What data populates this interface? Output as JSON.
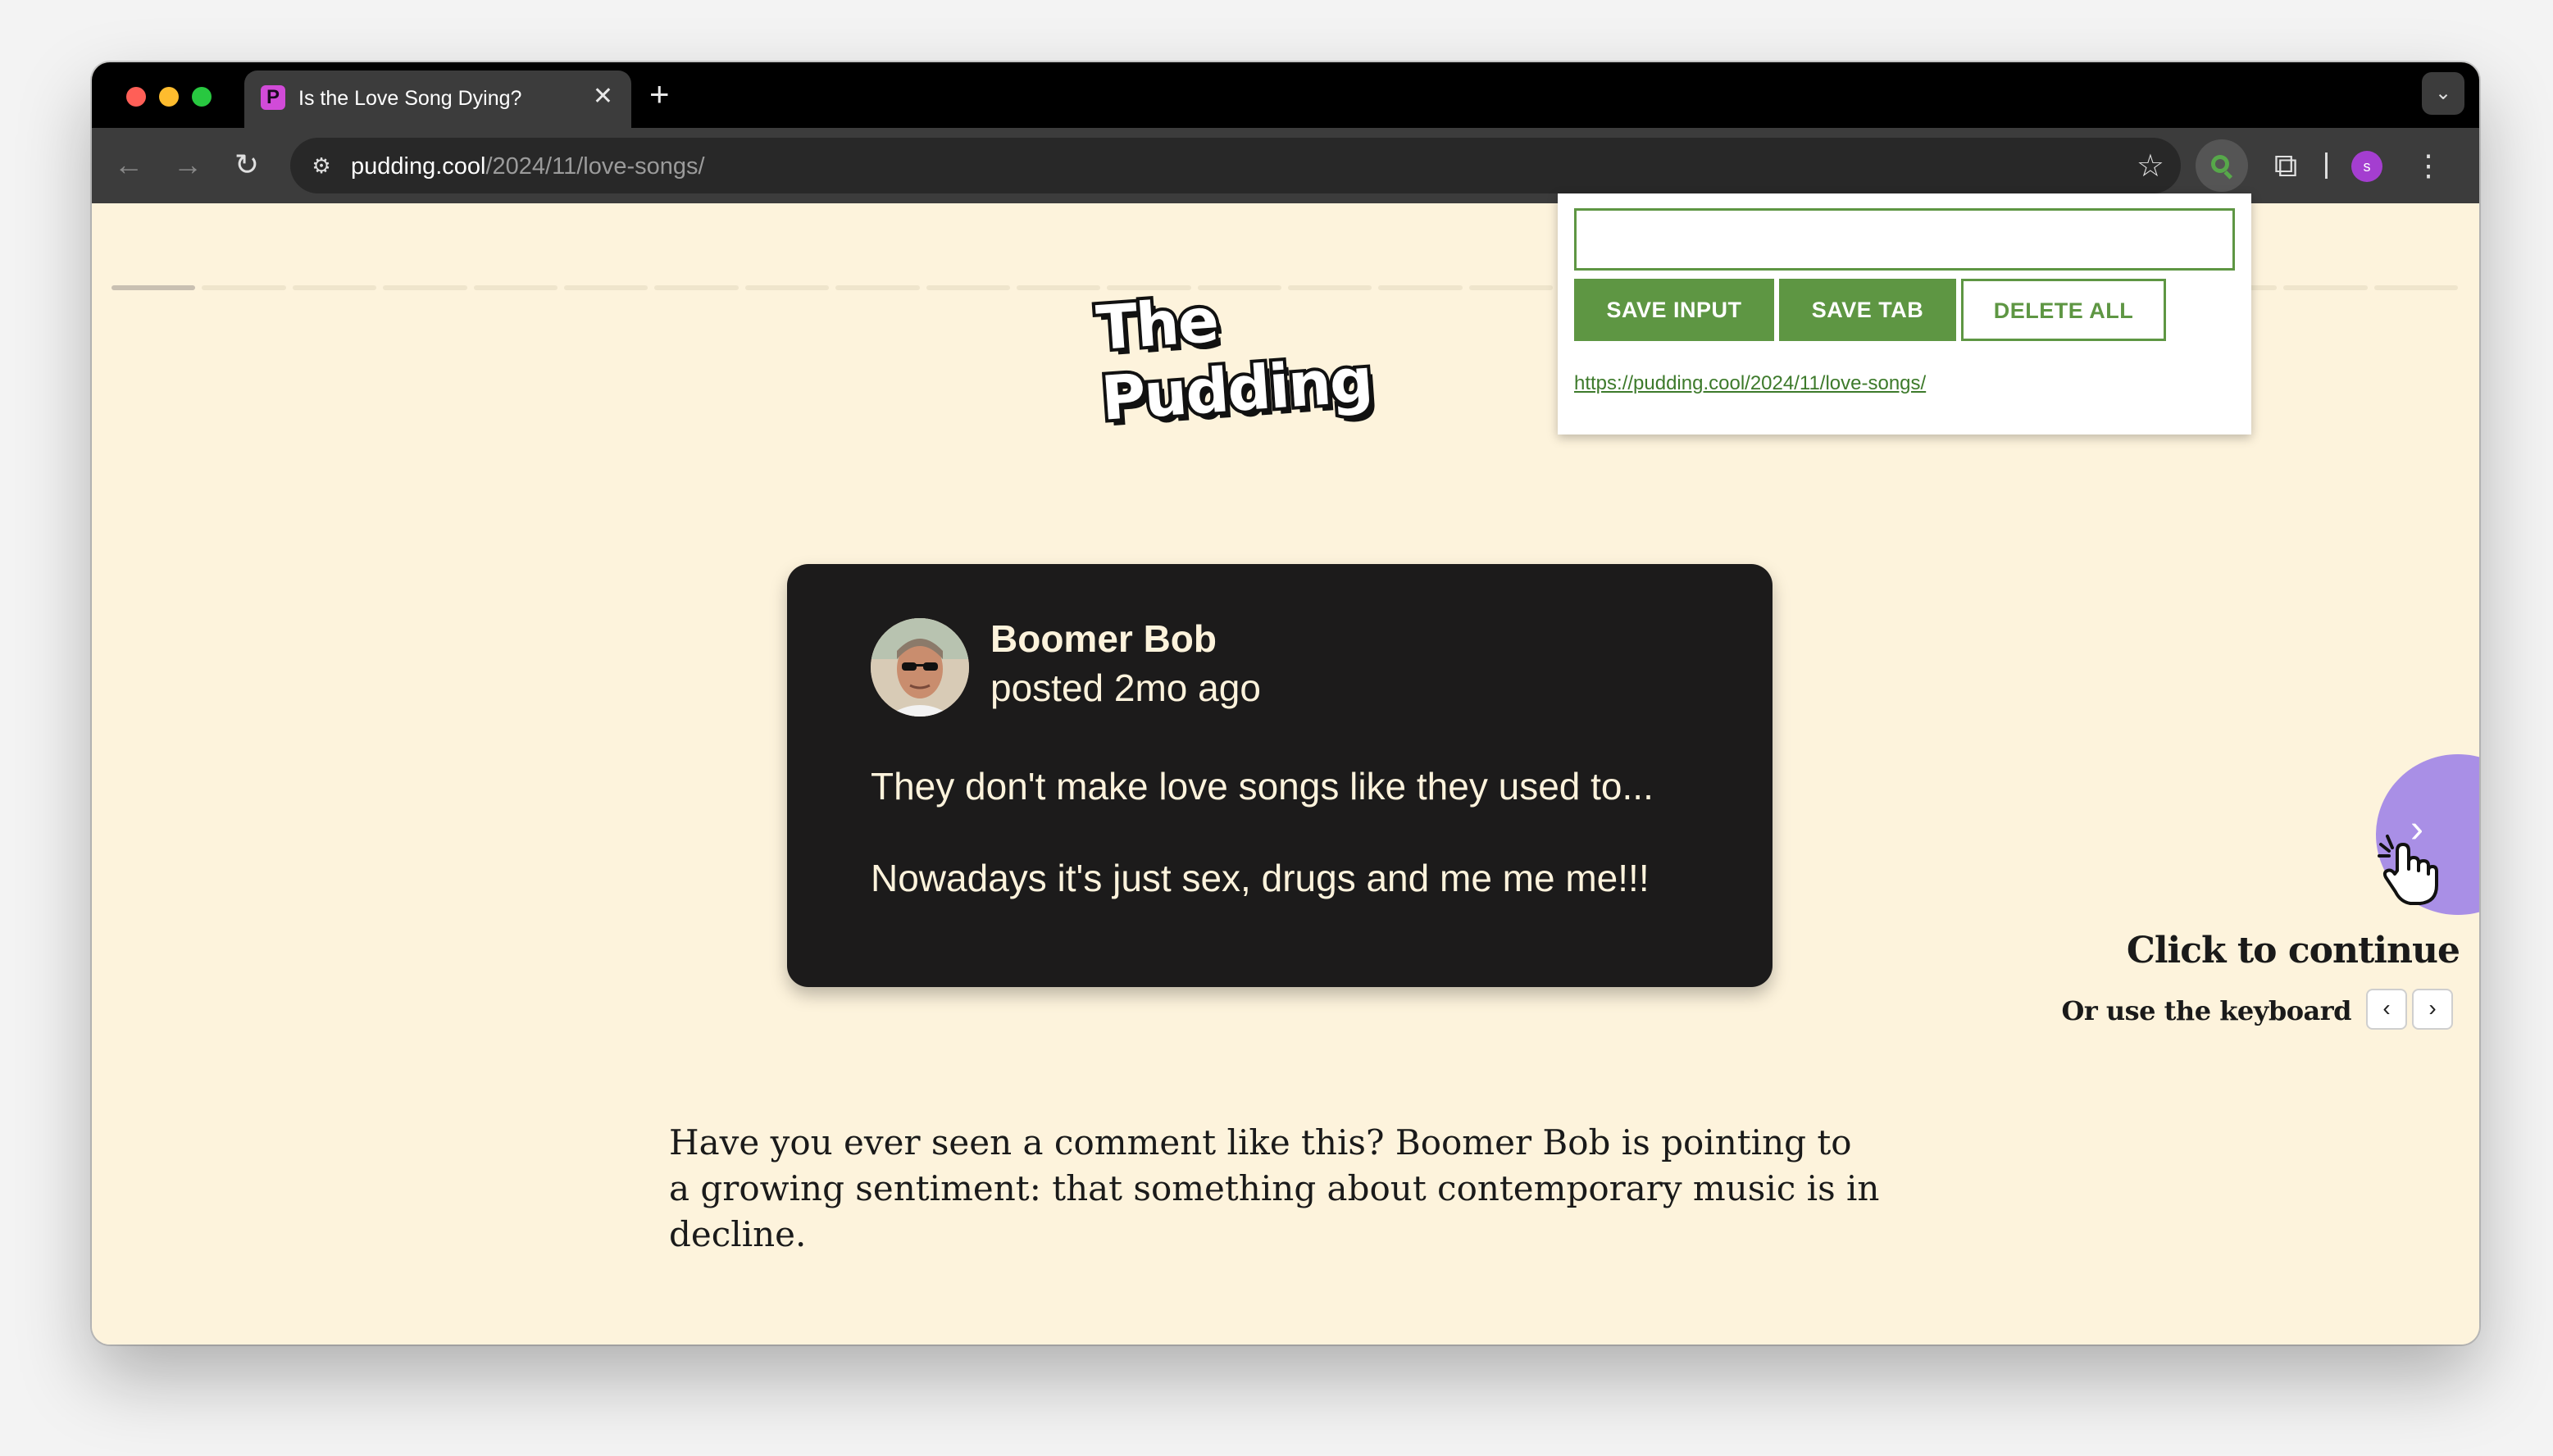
{
  "browser": {
    "tab": {
      "title": "Is the Love Song Dying?",
      "favicon": "P",
      "close": "✕"
    },
    "new_tab": "+",
    "address": {
      "host": "pudding.cool",
      "path": "/2024/11/love-songs/"
    },
    "profile_initial": "s",
    "icons": [
      "back-icon",
      "forward-icon",
      "reload-icon",
      "site-info-icon",
      "bookmark-star-icon",
      "extension-search-icon",
      "extensions-puzzle-icon",
      "menu-kebab-icon",
      "tab-list-chevron-icon"
    ]
  },
  "page": {
    "logo": "The Pudding",
    "progress": {
      "segments": 26,
      "current": 1
    },
    "comment": {
      "author": "Boomer Bob",
      "posted": "posted 2mo ago",
      "line1": "They don't make love songs like they used to...",
      "line2": "Nowadays it's just sex, drugs and me me me!!!"
    },
    "body": "Have you ever seen a comment like this? Boomer Bob is pointing to a growing sentiment: that something about contemporary music is in decline.",
    "nav": {
      "click_continue": "Click to continue",
      "keyboard_hint": "Or use the keyboard",
      "prev_key": "‹",
      "next_key": "›",
      "next_chevron": "›"
    }
  },
  "popup": {
    "input_value": "",
    "save_input": "SAVE INPUT",
    "save_tab": "SAVE TAB",
    "delete_all": "DELETE ALL",
    "saved_links": [
      "https://pudding.cool/2024/11/love-songs/"
    ],
    "accent": "#5e9643"
  },
  "colors": {
    "page_bg": "#fdf3dc",
    "card_bg": "#1c1b1b",
    "next_button": "#a98fe6"
  }
}
